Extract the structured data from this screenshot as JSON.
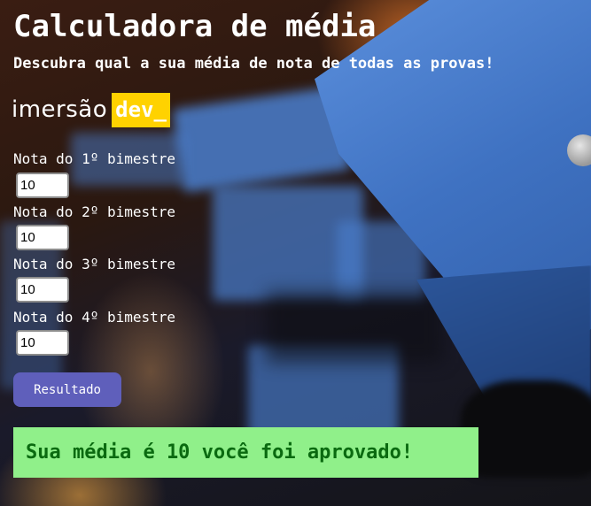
{
  "header": {
    "title": "Calculadora de média",
    "subtitle": "Descubra qual a sua média de nota de todas as provas!"
  },
  "brand": {
    "imersao": "imersão",
    "dev": "dev_",
    "highlight_color": "#ffd200"
  },
  "fields": [
    {
      "label": "Nota do 1º bimestre",
      "value": "10"
    },
    {
      "label": "Nota do 2º bimestre",
      "value": "10"
    },
    {
      "label": "Nota do 3º bimestre",
      "value": "10"
    },
    {
      "label": "Nota do 4º bimestre",
      "value": "10"
    }
  ],
  "button": {
    "label": "Resultado",
    "color": "#5f5fbb"
  },
  "result": {
    "text": "Sua média é 10 você foi aprovado!",
    "background": "#90f08a",
    "text_color": "#0a6a10"
  }
}
